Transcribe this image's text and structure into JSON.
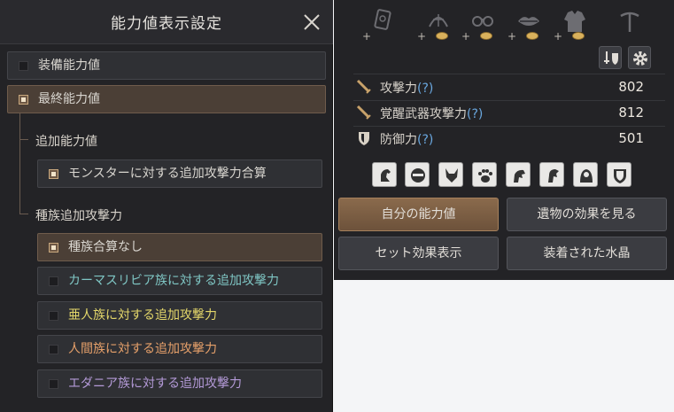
{
  "settings": {
    "title": "能力値表示設定",
    "options": {
      "equip": "装備能力値",
      "final": "最終能力値",
      "additional_label": "追加能力値",
      "monster_sum": "モンスターに対する追加攻撃力合算",
      "race_label": "種族追加攻撃力",
      "race_none": "種族合算なし",
      "kamasylvia": "カーマスリビア族に対する追加攻撃力",
      "demihuman": "亜人族に対する追加攻撃力",
      "human": "人間族に対する追加攻撃力",
      "edania": "エダニア族に対する追加攻撃力"
    },
    "colors": {
      "kamasylvia": "#7fc6c4",
      "demihuman": "#e4d76a",
      "human": "#e6a06a",
      "edania": "#b49ad8"
    }
  },
  "stats": {
    "equip_slots": [
      "tablet-icon",
      "lantern-icon",
      "handcuff-icon",
      "lips-icon",
      "armor-icon",
      "pickaxe-icon"
    ],
    "rows": [
      {
        "name": "攻撃力",
        "q": "(?)",
        "value": "802"
      },
      {
        "name": "覚醒武器攻撃力",
        "q": "(?)",
        "value": "812"
      },
      {
        "name": "防御力",
        "q": "(?)",
        "value": "501"
      }
    ],
    "buttons": {
      "my_stats": "自分の能力値",
      "relic": "遺物の効果を見る",
      "set_effect": "セット効果表示",
      "crystal": "装着された水晶"
    },
    "accent": "#c8a26a"
  }
}
